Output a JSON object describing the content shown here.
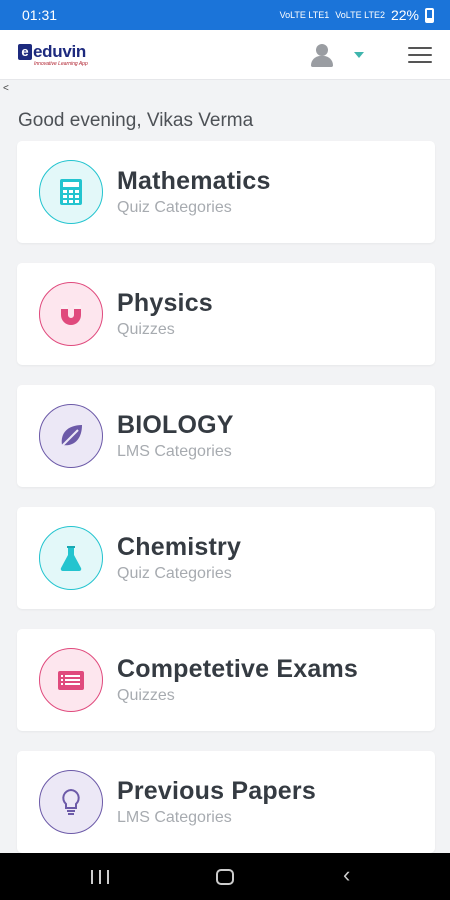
{
  "status": {
    "time": "01:31",
    "signal1": "VoLTE LTE1",
    "signal2": "VoLTE LTE2",
    "battery": "22%"
  },
  "header": {
    "logo_letter": "e",
    "logo_text": "eduvin",
    "logo_tagline": "Innovative Learning App",
    "accent": "#1d2a7e"
  },
  "greeting": "Good evening, Vikas Verma",
  "categories": [
    {
      "title": "Mathematics",
      "subtitle": "Quiz Categories",
      "icon": "calculator-icon",
      "color": "#23c4cf",
      "bg": "#e3f8f9"
    },
    {
      "title": "Physics",
      "subtitle": "Quizzes",
      "icon": "magnet-icon",
      "color": "#e04a7d",
      "bg": "#fde6ee"
    },
    {
      "title": "BIOLOGY",
      "subtitle": "LMS Categories",
      "icon": "leaf-icon",
      "color": "#6c5aa8",
      "bg": "#ece8f6"
    },
    {
      "title": "Chemistry",
      "subtitle": "Quiz Categories",
      "icon": "flask-icon",
      "color": "#23c4cf",
      "bg": "#e3f8f9"
    },
    {
      "title": "Competetive Exams",
      "subtitle": "Quizzes",
      "icon": "list-icon",
      "color": "#e04a7d",
      "bg": "#fde6ee"
    },
    {
      "title": "Previous Papers",
      "subtitle": "LMS Categories",
      "icon": "bulb-icon",
      "color": "#6c5aa8",
      "bg": "#ece8f6"
    }
  ]
}
